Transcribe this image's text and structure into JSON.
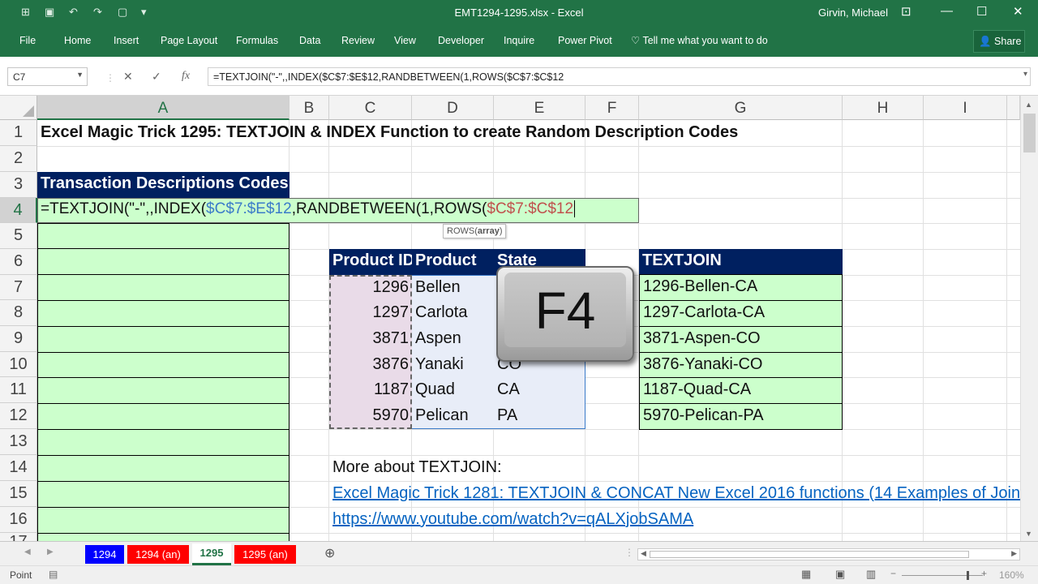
{
  "window": {
    "title": "EMT1294-1295.xlsx - Excel",
    "user": "Girvin, Michael",
    "qat_icons": [
      "autosave-icon",
      "save-icon",
      "undo-icon",
      "redo-icon",
      "open-icon",
      "new-icon",
      "customize-icon"
    ]
  },
  "ribbon": {
    "tabs": [
      "File",
      "Home",
      "Insert",
      "Page Layout",
      "Formulas",
      "Data",
      "Review",
      "View",
      "Developer",
      "Inquire",
      "Power Pivot"
    ],
    "tell_me": "Tell me what you want to do",
    "share": "Share"
  },
  "formula_bar": {
    "name_box": "C7",
    "cancel": "✕",
    "enter": "✓",
    "fx": "fx",
    "formula": "=TEXTJOIN(\"-\",,INDEX($C$7:$E$12,RANDBETWEEN(1,ROWS($C$7:$C$12"
  },
  "grid": {
    "columns": [
      "A",
      "B",
      "C",
      "D",
      "E",
      "F",
      "G",
      "H",
      "I"
    ],
    "rows": [
      "1",
      "2",
      "3",
      "4",
      "5",
      "6",
      "7",
      "8",
      "9",
      "10",
      "11",
      "12",
      "13",
      "14",
      "15",
      "16",
      "17"
    ],
    "title_cell": "Excel Magic Trick 1295: TEXTJOIN & INDEX Function to create Random Description Codes",
    "desc_header": "Transaction Descriptions Codes",
    "edit_formula": {
      "p1": "=TEXTJOIN(\"-\",,INDEX(",
      "p2": "$C$7:$E$12",
      "p3": ",RANDBETWEEN(",
      "p4": "1,ROWS(",
      "p5": "$C$7:$C$12"
    },
    "tooltip": {
      "fn": "ROWS(",
      "arg": "array",
      "end": ")"
    },
    "table": {
      "headers": [
        "Product ID",
        "Product",
        "State"
      ],
      "rows": [
        [
          "1296",
          "Bellen",
          ""
        ],
        [
          "1297",
          "Carlota",
          ""
        ],
        [
          "3871",
          "Aspen",
          ""
        ],
        [
          "3876",
          "Yanaki",
          "CO"
        ],
        [
          "1187",
          "Quad",
          "CA"
        ],
        [
          "5970",
          "Pelican",
          "PA"
        ]
      ]
    },
    "textjoin": {
      "header": "TEXTJOIN",
      "values": [
        "1296-Bellen-CA",
        "1297-Carlota-CA",
        "3871-Aspen-CO",
        "3876-Yanaki-CO",
        "1187-Quad-CA",
        "5970-Pelican-PA"
      ]
    },
    "more_about": "More about TEXTJOIN:",
    "link1": "Excel Magic Trick 1281: TEXTJOIN & CONCAT New Excel 2016 functions (14 Examples of Join",
    "link2": "https://www.youtube.com/watch?v=qALXjobSAMA"
  },
  "key_overlay": "F4",
  "sheet_tabs": [
    {
      "label": "1294",
      "color": "#0000ff"
    },
    {
      "label": "1294 (an)",
      "color": "#ff0000"
    },
    {
      "label": "1295",
      "color": "#ffffff"
    },
    {
      "label": "1295 (an)",
      "color": "#ff0000"
    }
  ],
  "status": {
    "mode": "Point",
    "zoom": "160%"
  },
  "colors": {
    "excel_green": "#217346",
    "navy": "#002060",
    "light_green": "#ccffcc",
    "ref_blue": "#3b7bc9",
    "ref_red": "#c0504d"
  }
}
